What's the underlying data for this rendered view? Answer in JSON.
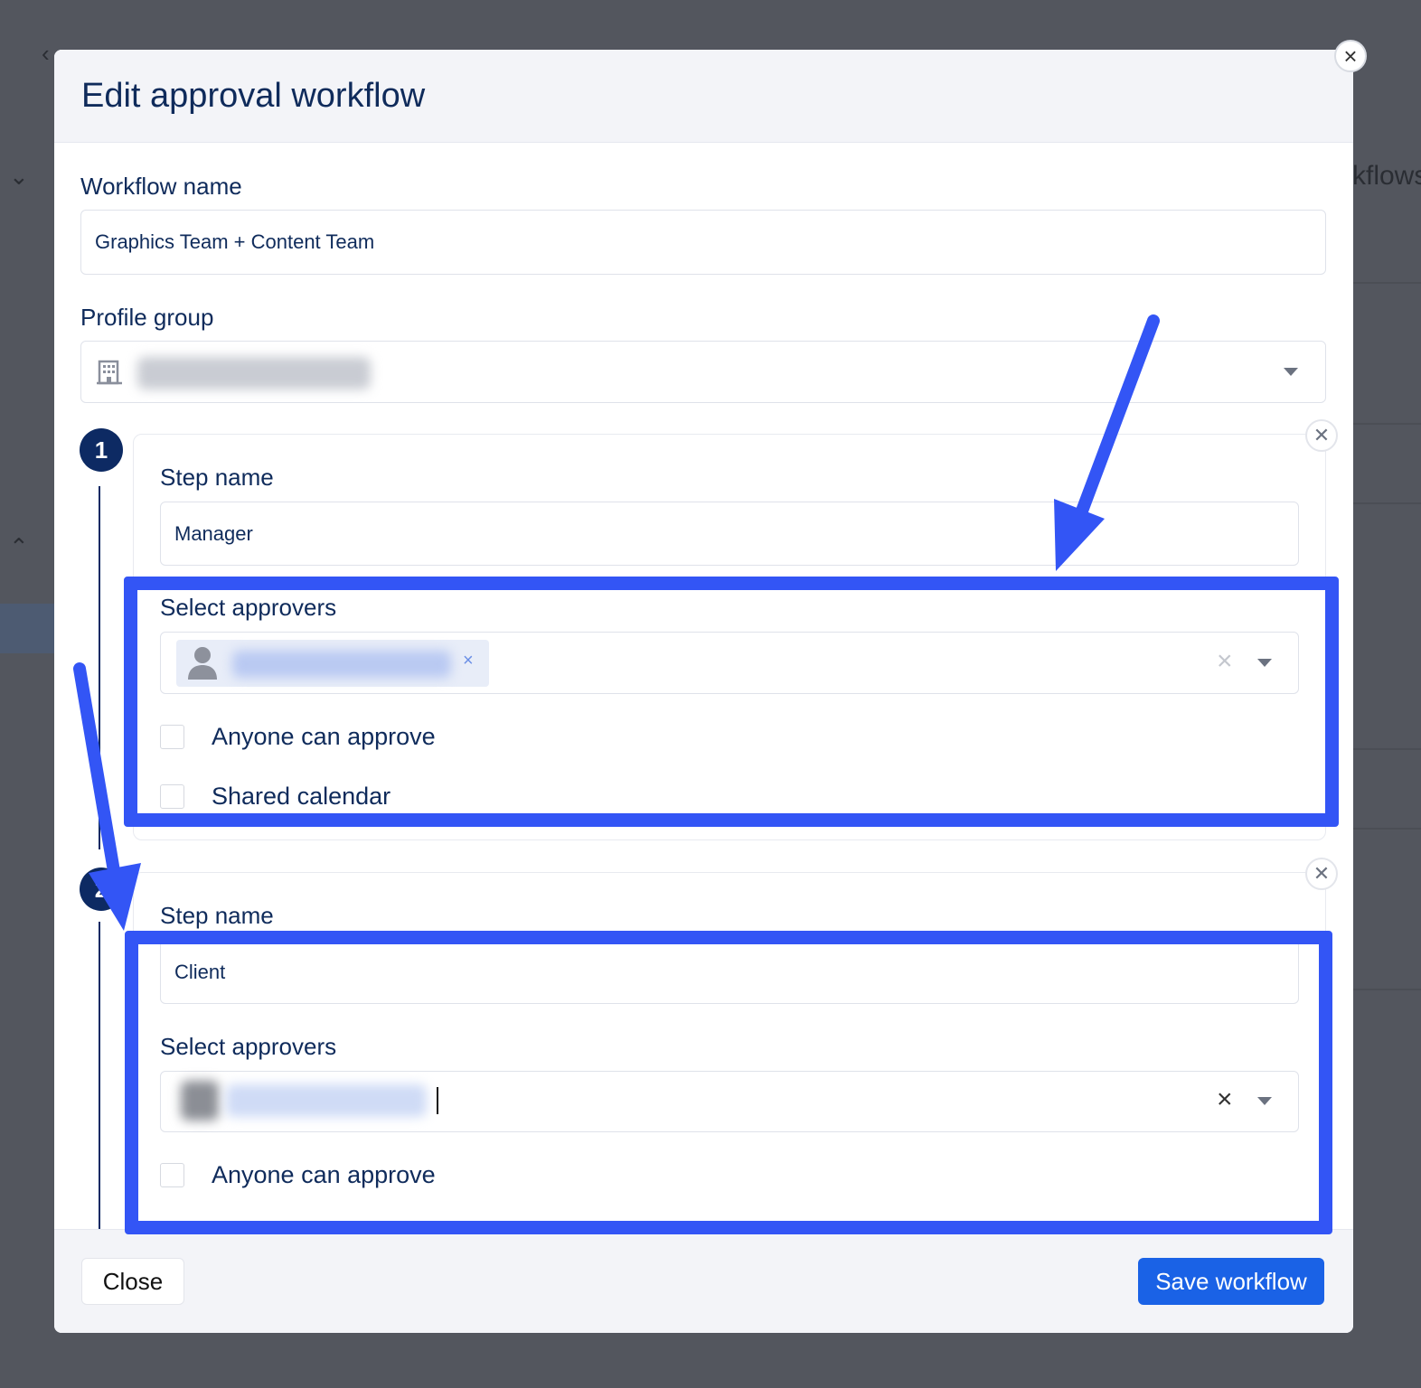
{
  "background": {
    "partial_text": "kflows"
  },
  "modal": {
    "title": "Edit approval workflow",
    "close_glyph": "×"
  },
  "workflow_name": {
    "label": "Workflow name",
    "value": "Graphics Team + Content Team"
  },
  "profile_group": {
    "label": "Profile group",
    "icon": "building-icon"
  },
  "steps": [
    {
      "number": "1",
      "step_name_label": "Step name",
      "step_name_value": "Manager",
      "approvers_label": "Select approvers",
      "chip_remove_glyph": "×",
      "clear_glyph": "×",
      "checkboxes": [
        "Anyone can approve",
        "Shared calendar"
      ]
    },
    {
      "number": "2",
      "step_name_label": "Step name",
      "step_name_value": "Client",
      "approvers_label": "Select approvers",
      "clear_glyph": "×",
      "checkboxes": [
        "Anyone can approve"
      ]
    }
  ],
  "footer": {
    "close_label": "Close",
    "save_label": "Save workflow"
  },
  "colors": {
    "overlay": "#53565e",
    "navy": "#0f2b5b",
    "highlight": "#3355f5",
    "save_button": "#1a62e6"
  }
}
